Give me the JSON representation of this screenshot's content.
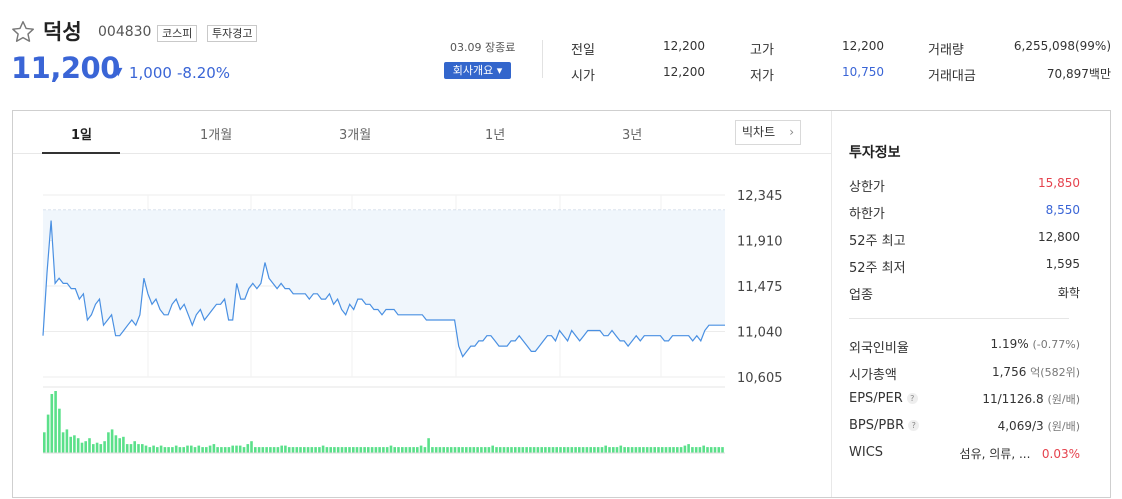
{
  "stock": {
    "name": "덕성",
    "code": "004830",
    "tags": [
      "코스피",
      "투자경고"
    ],
    "price": "11,200",
    "change_arrow": "▼",
    "change_amount": "1,000",
    "change_percent": "-8.20%",
    "date_status": "03.09 장종료",
    "company_button": "회사개요 ▾"
  },
  "stats": {
    "prev_close_label": "전일",
    "prev_close": "12,200",
    "open_label": "시가",
    "open": "12,200",
    "high_label": "고가",
    "high": "12,200",
    "low_label": "저가",
    "low": "10,750",
    "volume_label": "거래량",
    "volume": "6,255,098(99%)",
    "trade_value_label": "거래대금",
    "trade_value": "70,897백만"
  },
  "tabs": [
    "1일",
    "1개월",
    "3개월",
    "1년",
    "3년"
  ],
  "big_chart_label": "빅차트",
  "investment_info": {
    "title": "투자정보",
    "upper_limit_label": "상한가",
    "upper_limit": "15,850",
    "lower_limit_label": "하한가",
    "lower_limit": "8,550",
    "high_52w_label": "52주 최고",
    "high_52w": "12,800",
    "low_52w_label": "52주 최저",
    "low_52w": "1,595",
    "sector_label": "업종",
    "sector": "화학",
    "foreign_ratio_label": "외국인비율",
    "foreign_ratio": "1.19%",
    "foreign_ratio_change": "(-0.77%)",
    "market_cap_label": "시가총액",
    "market_cap": "1,756",
    "market_cap_unit": "억(582위)",
    "eps_per_label": "EPS/PER",
    "eps_per": "11/1126.8",
    "eps_per_unit": "(원/배)",
    "bps_pbr_label": "BPS/PBR",
    "bps_pbr": "4,069/3",
    "bps_pbr_unit": "(원/배)",
    "wics_label": "WICS",
    "wics": "섬유, 의류, ...",
    "wics_change": "0.03%"
  },
  "colors": {
    "down_blue": "#3a65d6",
    "up_red": "#e5424d",
    "line": "#4a90e2",
    "area_fill": "#f0f6fc",
    "volume_bar": "#5be08a"
  },
  "chart_data": {
    "type": "line",
    "ylim": [
      10605,
      12345
    ],
    "y_ticks": [
      "12,345",
      "11,910",
      "11,475",
      "11,040",
      "10,605"
    ],
    "x_ticks": [
      "10",
      "11",
      "12",
      "13",
      "14",
      "15"
    ],
    "prev_close_reference": 12200,
    "price_series": [
      11000,
      11600,
      12100,
      11500,
      11550,
      11500,
      11500,
      11450,
      11450,
      11350,
      11400,
      11150,
      11200,
      11300,
      11350,
      11100,
      11150,
      11200,
      11000,
      11000,
      11050,
      11100,
      11150,
      11100,
      11200,
      11550,
      11400,
      11300,
      11350,
      11250,
      11200,
      11200,
      11300,
      11350,
      11250,
      11300,
      11200,
      11100,
      11200,
      11250,
      11150,
      11200,
      11250,
      11300,
      11300,
      11350,
      11150,
      11150,
      11500,
      11350,
      11350,
      11450,
      11500,
      11450,
      11500,
      11700,
      11550,
      11500,
      11450,
      11500,
      11450,
      11450,
      11400,
      11400,
      11400,
      11400,
      11350,
      11400,
      11400,
      11350,
      11350,
      11400,
      11300,
      11350,
      11250,
      11200,
      11300,
      11250,
      11350,
      11350,
      11300,
      11300,
      11250,
      11250,
      11200,
      11250,
      11250,
      11250,
      11200,
      11200,
      11200,
      11200,
      11200,
      11200,
      11200,
      11150,
      11150,
      11150,
      11150,
      11150,
      11150,
      11150,
      11150,
      10900,
      10800,
      10850,
      10900,
      10900,
      10950,
      10950,
      11000,
      11000,
      10950,
      10900,
      10900,
      10900,
      10950,
      10950,
      11000,
      10950,
      10900,
      10850,
      10850,
      10900,
      10950,
      11000,
      11000,
      10950,
      11050,
      11000,
      10950,
      11050,
      11000,
      10950,
      11000,
      11050,
      11050,
      11050,
      11050,
      11000,
      11000,
      11050,
      11000,
      10950,
      10950,
      10900,
      10950,
      11000,
      10950,
      11000,
      11000,
      11000,
      11000,
      11000,
      10950,
      10950,
      11000,
      11000,
      11000,
      11000,
      11000,
      10950,
      11000,
      10950,
      11050,
      11100,
      11100,
      11100,
      11100,
      11100
    ],
    "volume_series": [
      14,
      26,
      40,
      42,
      30,
      14,
      16,
      11,
      12,
      10,
      7,
      8,
      10,
      6,
      7,
      6,
      8,
      14,
      16,
      12,
      10,
      11,
      6,
      6,
      8,
      6,
      6,
      5,
      4,
      5,
      4,
      5,
      4,
      4,
      4,
      5,
      4,
      4,
      5,
      5,
      4,
      5,
      4,
      4,
      5,
      6,
      4,
      4,
      4,
      4,
      5,
      5,
      5,
      4,
      6,
      8,
      4,
      4,
      4,
      4,
      4,
      4,
      4,
      5,
      5,
      4,
      4,
      4,
      4,
      4,
      4,
      4,
      4,
      4,
      5,
      4,
      4,
      4,
      4,
      4,
      4,
      4,
      4,
      4,
      4,
      4,
      4,
      4,
      4,
      4,
      4,
      4,
      5,
      4,
      4,
      4,
      4,
      4,
      4,
      4,
      5,
      4,
      10,
      4,
      4,
      4,
      4,
      4,
      4,
      4,
      4,
      4,
      4,
      4,
      4,
      4,
      4,
      4,
      4,
      5,
      4,
      4,
      4,
      4,
      4,
      4,
      4,
      4,
      4,
      4,
      4,
      4,
      4,
      4,
      4,
      4,
      4,
      4,
      4,
      4,
      4,
      4,
      4,
      4,
      4,
      4,
      4,
      4,
      4,
      5,
      4,
      4,
      4,
      5,
      4,
      4,
      4,
      4,
      4,
      4,
      4,
      4,
      4,
      4,
      4,
      4,
      4,
      4,
      4,
      4,
      5,
      6,
      4,
      4,
      4,
      5,
      4,
      4,
      4,
      4,
      4
    ]
  }
}
